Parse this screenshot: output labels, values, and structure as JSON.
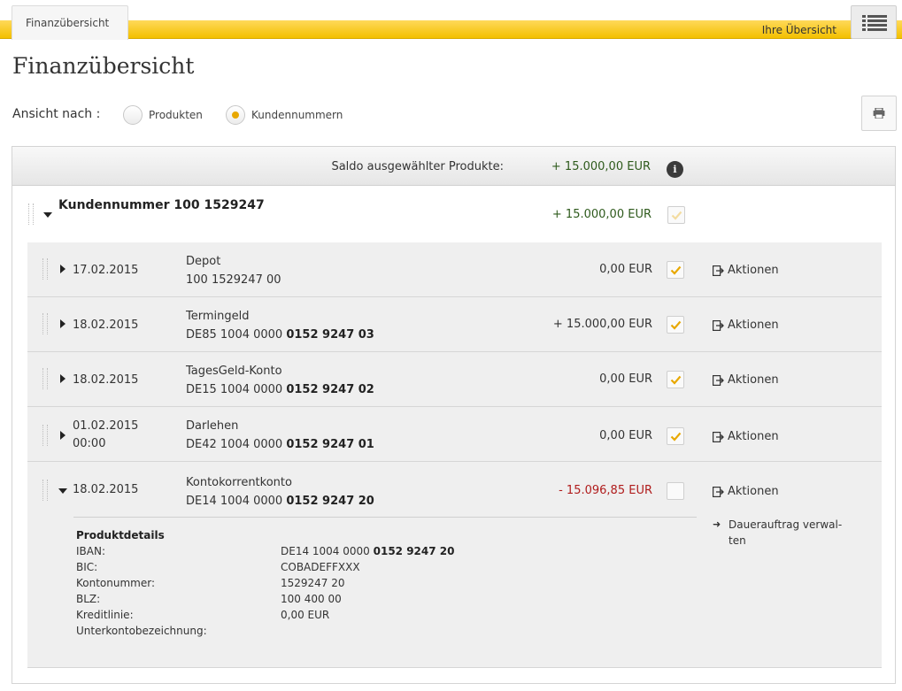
{
  "topbar": {
    "tab_label": "Finanzübersicht",
    "right_link": "Ihre Übersicht",
    "menu_icon": "list-menu-icon"
  },
  "page": {
    "title": "Finanzübersicht"
  },
  "view": {
    "label": "Ansicht nach :",
    "options": [
      {
        "label": "Produkten",
        "selected": false
      },
      {
        "label": "Kundennummern",
        "selected": true
      }
    ],
    "print_icon": "printer-icon"
  },
  "saldo": {
    "label": "Saldo ausgewählter Produkte:",
    "value": "+ 15.000,00 EUR"
  },
  "customer": {
    "title": "Kundennummer 100 1529247",
    "amount": "+ 15.000,00 EUR"
  },
  "rows": [
    {
      "date": "17.02.2015",
      "time": "",
      "name": "Depot",
      "iban_prefix": "100 1529247 00",
      "iban_bold": "",
      "amount": "0,00 EUR",
      "checked": true,
      "action": "Aktionen"
    },
    {
      "date": "18.02.2015",
      "time": "",
      "name": "Termingeld",
      "iban_prefix": "DE85 1004 0000 ",
      "iban_bold": "0152 9247 03",
      "amount": "+ 15.000,00 EUR",
      "checked": true,
      "action": "Aktionen"
    },
    {
      "date": "18.02.2015",
      "time": "",
      "name": "TagesGeld-Konto",
      "iban_prefix": "DE15 1004 0000 ",
      "iban_bold": "0152 9247 02",
      "amount": "0,00 EUR",
      "checked": true,
      "action": "Aktionen"
    },
    {
      "date": "01.02.2015",
      "time": "00:00",
      "name": "Darlehen",
      "iban_prefix": "DE42 1004 0000 ",
      "iban_bold": "0152 9247 01",
      "amount": "0,00 EUR",
      "checked": true,
      "action": "Aktionen"
    },
    {
      "date": "18.02.2015",
      "time": "",
      "name": "Kontokorrentkonto",
      "iban_prefix": "DE14 1004 0000 ",
      "iban_bold": "0152 9247 20",
      "amount": "- 15.096,85 EUR",
      "checked": false,
      "action": "Aktionen"
    }
  ],
  "details": {
    "heading": "Produktdetails",
    "iban_label": "IBAN:",
    "iban_prefix": "DE14 1004 0000 ",
    "iban_bold": "0152 9247 20",
    "bic_label": "BIC:",
    "bic": "COBADEFFXXX",
    "kto_label": "Kontonummer:",
    "kto": "1529247 20",
    "blz_label": "BLZ:",
    "blz": "100 400 00",
    "kredit_label": "Kreditlinie:",
    "kredit": "0,00 EUR",
    "unterkonto_label": "Unterkontobezeichnung:",
    "unterkonto": "",
    "sublink": "Dauerauftrag verwal-ten"
  },
  "colors": {
    "accent": "#f3c000",
    "positive": "#2e5a1c",
    "negative": "#b01c1c",
    "check": "#e8a800"
  }
}
